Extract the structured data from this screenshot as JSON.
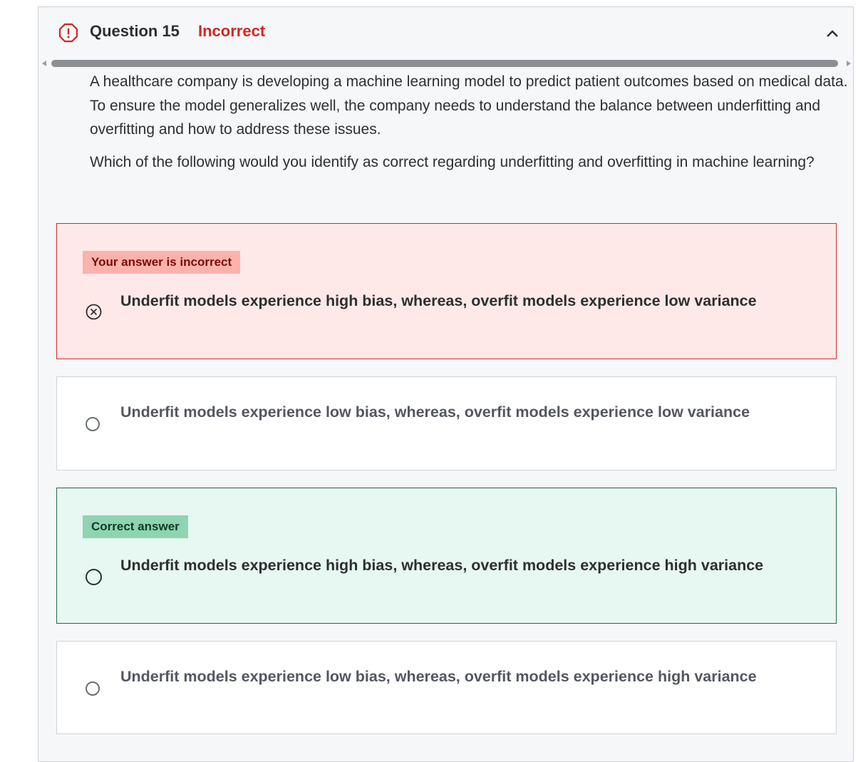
{
  "header": {
    "question_title": "Question 15",
    "status": "Incorrect",
    "status_color": "#d1271f",
    "status_icon": "alert-octagon-icon",
    "collapse_icon": "chevron-up-icon"
  },
  "question": {
    "paragraph_1": "A healthcare company is developing a machine learning model to predict patient outcomes based on medical data. To ensure the model generalizes well, the company needs to understand the balance between underfitting and overfitting and how to address these issues.",
    "paragraph_2": "Which of the following would you identify as correct regarding underfitting and overfitting in machine learning?"
  },
  "options": [
    {
      "state": "selected-incorrect",
      "badge": "Your answer is incorrect",
      "text": "Underfit models experience high bias, whereas, overfit models experience low variance",
      "icon": "x-circle-icon"
    },
    {
      "state": "unselected",
      "badge": "",
      "text": "Underfit models experience low bias, whereas, overfit models experience low variance",
      "icon": "radio-empty-icon"
    },
    {
      "state": "correct",
      "badge": "Correct answer",
      "text": "Underfit models experience high bias, whereas, overfit models experience high variance",
      "icon": "radio-empty-icon"
    },
    {
      "state": "unselected",
      "badge": "",
      "text": "Underfit models experience low bias, whereas, overfit models experience high variance",
      "icon": "radio-empty-icon"
    }
  ],
  "colors": {
    "incorrect_bg": "#ffe9e8",
    "incorrect_border": "#c9302a",
    "correct_bg": "#e7f7f1",
    "correct_border": "#1f6b49"
  }
}
